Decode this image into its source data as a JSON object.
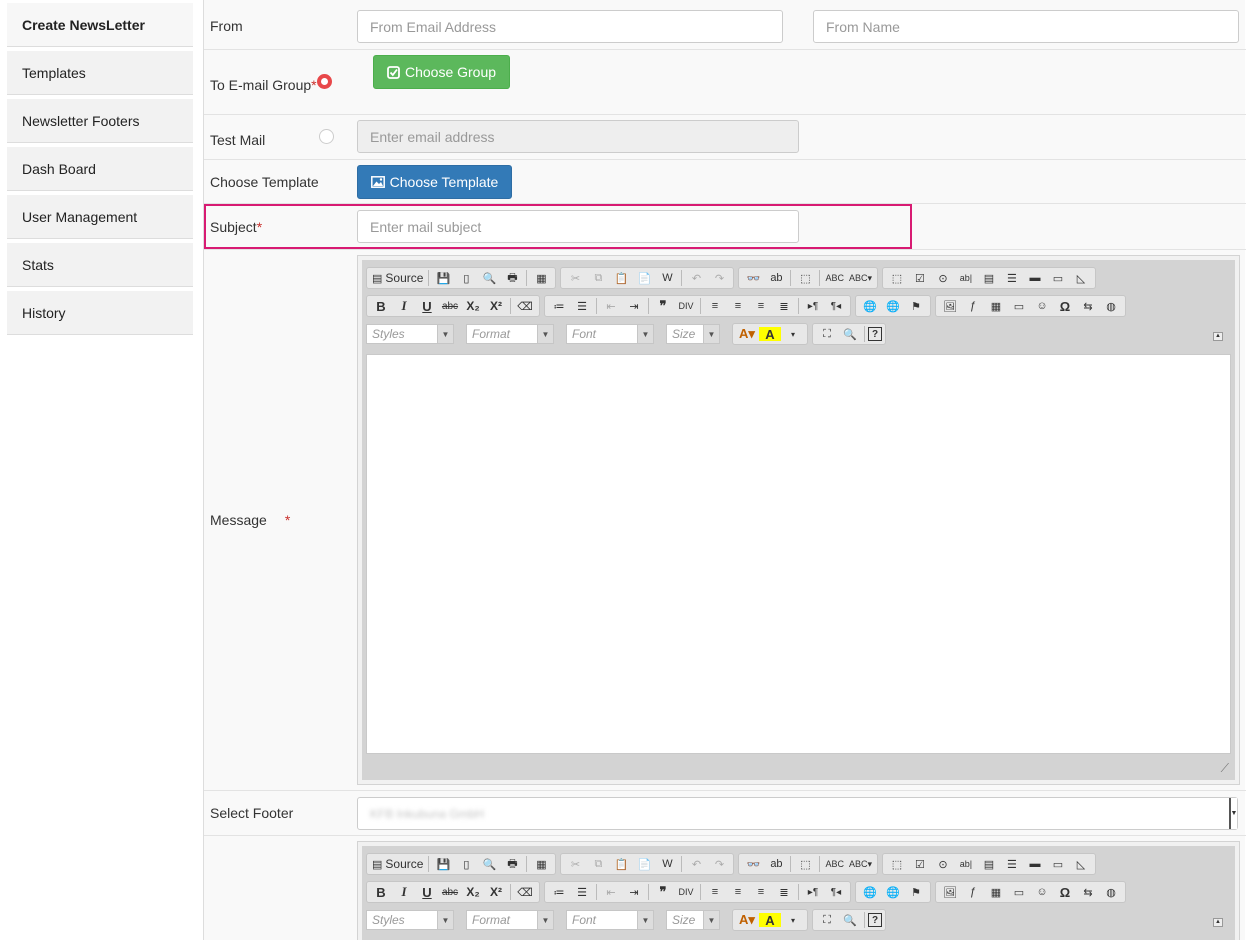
{
  "sidebar": {
    "items": [
      {
        "label": "Create NewsLetter"
      },
      {
        "label": "Templates"
      },
      {
        "label": "Newsletter Footers"
      },
      {
        "label": "Dash Board"
      },
      {
        "label": "User Management"
      },
      {
        "label": "Stats"
      },
      {
        "label": "History"
      }
    ],
    "active_index": 0
  },
  "form": {
    "from": {
      "label": "From",
      "email_placeholder": "From Email Address",
      "name_placeholder": "From Name"
    },
    "to_group": {
      "label": "To E-mail Group",
      "required_mark": "*",
      "button": "Choose Group",
      "button_icon": "check-square-icon",
      "radio_selected": true
    },
    "test_mail": {
      "label": "Test Mail",
      "placeholder": "Enter email address",
      "radio_selected": false
    },
    "template": {
      "label": "Choose Template",
      "button": "Choose Template",
      "button_icon": "picture-icon"
    },
    "subject": {
      "label": "Subject",
      "required_mark": "*",
      "placeholder": "Enter mail subject"
    },
    "message": {
      "label": "Message",
      "required_mark": "*"
    },
    "footer": {
      "label": "Select Footer",
      "selected_value": "KFB Inkubuna GmbH"
    }
  },
  "editor": {
    "source_label": "Source",
    "combos": {
      "styles": "Styles",
      "format": "Format",
      "font": "Font",
      "size": "Size"
    },
    "bold": "B",
    "italic": "I",
    "underline": "U",
    "strike": "abc",
    "subscript": "X₂",
    "superscript": "X²"
  },
  "colors": {
    "required": "#c9302c",
    "green_button": "#5cb85c",
    "blue_button": "#337ab7",
    "highlight": "#d81b73",
    "radio_active": "#e8484a"
  }
}
